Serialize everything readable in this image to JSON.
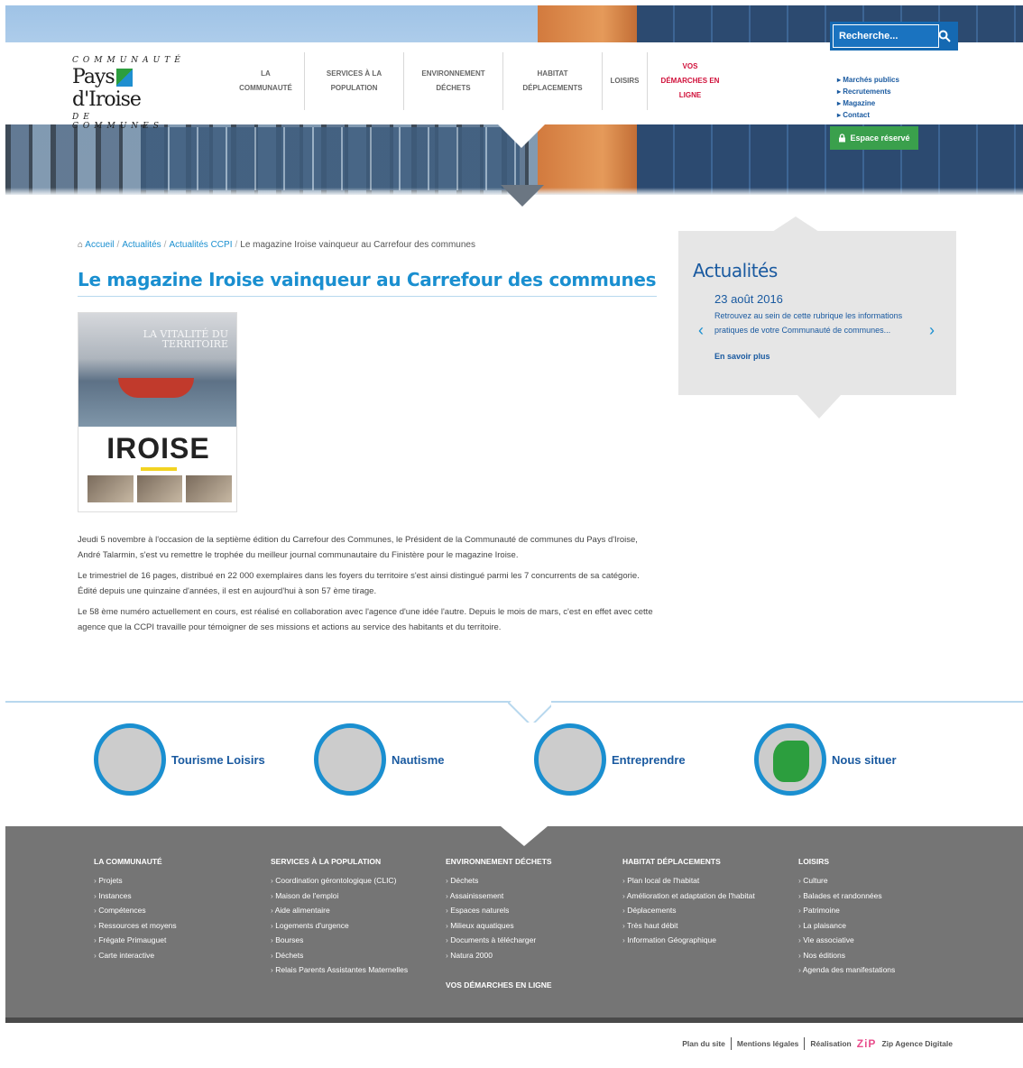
{
  "header": {
    "logo": {
      "line1": "COMMUNAUTÉ",
      "line2a": "Pays",
      "line2b": "d'Iroise",
      "line3": "DE COMMUNES"
    },
    "nav": [
      {
        "label": "LA COMMUNAUTÉ"
      },
      {
        "label": "SERVICES À LA POPULATION"
      },
      {
        "label": "ENVIRONNEMENT DÉCHETS"
      },
      {
        "label": "HABITAT DÉPLACEMENTS"
      },
      {
        "label": "LOISIRS"
      },
      {
        "label": "VOS DÉMARCHES EN LIGNE"
      }
    ],
    "search_placeholder": "Recherche...",
    "top_links": [
      "Marchés publics",
      "Recrutements",
      "Magazine",
      "Contact"
    ],
    "espace_label": "Espace réservé"
  },
  "breadcrumb": {
    "home": "Accueil",
    "l1": "Actualités",
    "l2": "Actualités CCPI",
    "current": "Le magazine Iroise vainqueur au Carrefour des communes"
  },
  "article": {
    "title": "Le magazine Iroise vainqueur au Carrefour des communes",
    "cover": {
      "brand": "IROISE",
      "photo_title": "LA VITALITÉ DU TERRITOIRE"
    },
    "paragraphs": [
      "Jeudi 5 novembre à l'occasion de la septième édition du Carrefour des Communes, le Président de la Communauté de communes du Pays d'Iroise, André Talarmin, s'est vu remettre le trophée du meilleur journal communautaire du Finistère pour le magazine Iroise.",
      "Le trimestriel de 16 pages, distribué en 22 000 exemplaires dans les foyers du territoire s'est ainsi distingué parmi les 7 concurrents de sa catégorie. Édité depuis une quinzaine d'années, il est en aujourd'hui à son 57 ème tirage.",
      "Le 58 ème numéro actuellement en cours, est réalisé en collaboration avec l'agence d'une idée l'autre. Depuis le mois de mars, c'est en effet avec cette agence que la CCPI travaille pour témoigner de ses missions et actions au service des habitants et du territoire."
    ]
  },
  "news": {
    "heading": "Actualités",
    "date": "23 août 2016",
    "text": "Retrouvez au sein de cette rubrique les informations pratiques de votre Communauté de communes...",
    "more": "En savoir plus",
    "prev": "‹",
    "next": "›"
  },
  "tiles": [
    {
      "label": "Tourisme Loisirs"
    },
    {
      "label": "Nautisme"
    },
    {
      "label": "Entreprendre"
    },
    {
      "label": "Nous situer"
    }
  ],
  "footer": {
    "cols": [
      {
        "heading": "LA COMMUNAUTÉ",
        "items": [
          "Projets",
          "Instances",
          "Compétences",
          "Ressources et moyens",
          "Frégate Primauguet",
          "Carte interactive"
        ]
      },
      {
        "heading": "SERVICES À LA POPULATION",
        "items": [
          "Coordination gérontologique (CLIC)",
          "Maison de l'emploi",
          "Aide alimentaire",
          "Logements d'urgence",
          "Bourses",
          "Déchets",
          "Relais Parents Assistantes Maternelles"
        ]
      },
      {
        "heading": "ENVIRONNEMENT DÉCHETS",
        "items": [
          "Déchets",
          "Assainissement",
          "Espaces naturels",
          "Milieux aquatiques",
          "Documents à télécharger",
          "Natura 2000"
        ],
        "after": "VOS DÉMARCHES EN LIGNE"
      },
      {
        "heading": "HABITAT DÉPLACEMENTS",
        "items": [
          "Plan local de l'habitat",
          "Amélioration et adaptation de l'habitat",
          "Déplacements",
          "Très haut débit",
          "Information Géographique"
        ]
      },
      {
        "heading": "LOISIRS",
        "items": [
          "Culture",
          "Balades et randonnées",
          "Patrimoine",
          "La plaisance",
          "Vie associative",
          "Nos éditions",
          "Agenda des manifestations"
        ]
      }
    ],
    "legal": {
      "sitemap": "Plan du site",
      "mentions": "Mentions légales",
      "realisation": "Réalisation",
      "zip": "ZiP",
      "agency": "Zip Agence Digitale"
    }
  }
}
